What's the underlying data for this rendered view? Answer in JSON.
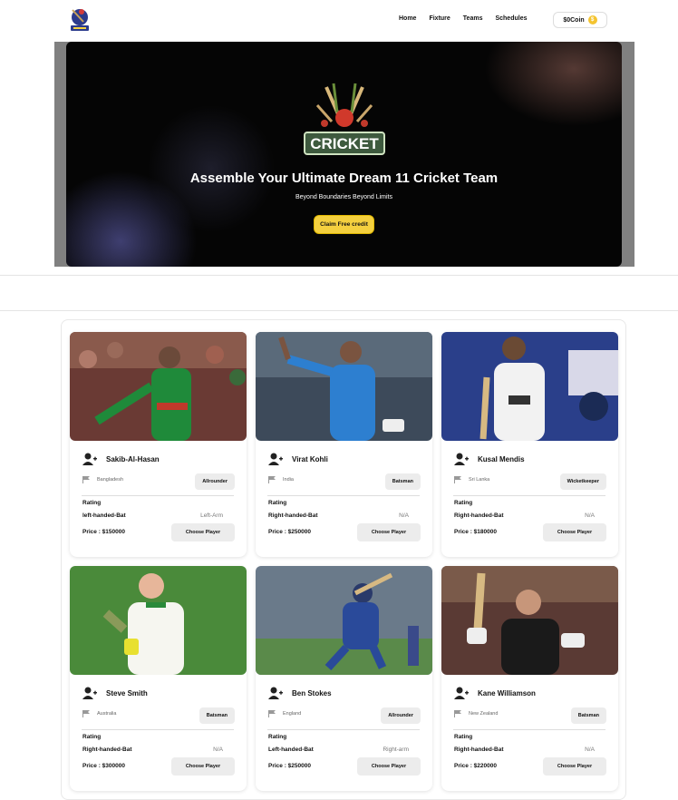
{
  "nav": {
    "links": [
      "Home",
      "Fixture",
      "Teams",
      "Schedules"
    ],
    "coin_label": "$0Coin",
    "coin_icon": "dollar-coin-icon"
  },
  "hero": {
    "logo_text": "CRICKET",
    "title": "Assemble Your Ultimate Dream 11 Cricket Team",
    "subtitle": "Beyond Boundaries Beyond Limits",
    "cta": "Claim Free credit"
  },
  "players": [
    {
      "name": "Sakib-Al-Hasan",
      "country": "Bangladesh",
      "role": "Allrounder",
      "rating_label": "Rating",
      "batting": "left-handed-Bat",
      "bowling": "Left-Arm",
      "price": "Price : $150000",
      "cta": "Choose Player"
    },
    {
      "name": "Virat Kohli",
      "country": "India",
      "role": "Batsman",
      "rating_label": "Rating",
      "batting": "Right-handed-Bat",
      "bowling": "N/A",
      "price": "Price : $250000",
      "cta": "Choose Player"
    },
    {
      "name": "Kusal Mendis",
      "country": "Sri Lanka",
      "role": "Wicketkeeper",
      "rating_label": "Rating",
      "batting": "Right-handed-Bat",
      "bowling": "N/A",
      "price": "Price : $180000",
      "cta": "Choose Player"
    },
    {
      "name": "Steve Smith",
      "country": "Australia",
      "role": "Batsman",
      "rating_label": "Rating",
      "batting": "Right-handed-Bat",
      "bowling": "N/A",
      "price": "Price : $300000",
      "cta": "Choose Player"
    },
    {
      "name": "Ben Stokes",
      "country": "England",
      "role": "Allrounder",
      "rating_label": "Rating",
      "batting": "Left-handed-Bat",
      "bowling": "Right-arm",
      "price": "Price : $250000",
      "cta": "Choose Player"
    },
    {
      "name": "Kane Williamson",
      "country": "New Zealand",
      "role": "Batsman",
      "rating_label": "Rating",
      "batting": "Right-handed-Bat",
      "bowling": "N/A",
      "price": "Price : $220000",
      "cta": "Choose Player"
    }
  ]
}
